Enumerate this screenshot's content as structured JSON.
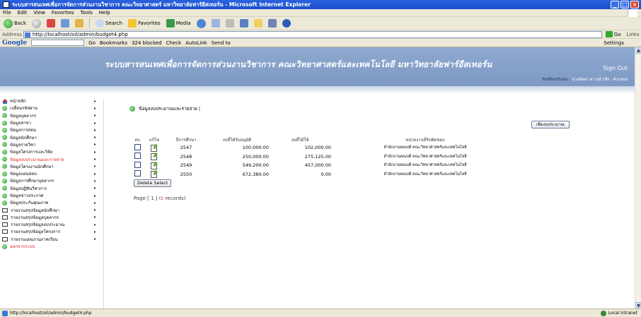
{
  "window": {
    "title": "ระบบสารสนเทศเพื่อการจัดการส่วนงานวิชาการ คณะวิทยาศาสตร์ มหาวิทยาลัยฟาร์อีสเทอร์น - Microsoft Internet Explorer"
  },
  "menu": [
    "File",
    "Edit",
    "View",
    "Favorites",
    "Tools",
    "Help"
  ],
  "toolbar": {
    "back": "Back",
    "search": "Search",
    "favorites": "Favorites",
    "media": "Media"
  },
  "address": {
    "label": "Address",
    "url": "http://localhost/oil/admin/budget4.php",
    "go": "Go",
    "links": "Links"
  },
  "google_bar": {
    "logo": "Google",
    "go": "Go",
    "bookmarks": "Bookmarks",
    "blocked": "324 blocked",
    "check": "Check",
    "autolink": "AutoLink",
    "sendto": "Send to",
    "settings": "Settings"
  },
  "banner": {
    "site_title": "ระบบสารสนเทศเพื่อการจัดการส่วนงานวิชาการ คณะวิทยาศาสตร์และเทคโนโลยี มหาวิทยาลัยฟาร์อีสเทอร์น",
    "signout": "Sign Out",
    "welcome_prefix": "ยินดีต้อนรับคุณ :",
    "welcome_user": "นางนัดดา ตาวงษ์ รหัส : ตำแหน่ง"
  },
  "sidebar": {
    "items": [
      {
        "icon": "home",
        "label": "หน้าหลัก",
        "active": false
      },
      {
        "icon": "bullet",
        "label": "เปลี่ยนรหัสผ่าน",
        "active": false
      },
      {
        "icon": "bullet",
        "label": "ข้อมูลบุคลากร",
        "active": false
      },
      {
        "icon": "bullet",
        "label": "ข้อมูลสาขา",
        "active": false
      },
      {
        "icon": "bullet",
        "label": "ข้อมูลการสอน",
        "active": false
      },
      {
        "icon": "bullet",
        "label": "ข้อมูลนักศึกษา",
        "active": false
      },
      {
        "icon": "bullet",
        "label": "ข้อมูลรายวิชา",
        "active": false
      },
      {
        "icon": "bullet",
        "label": "ข้อมูลโครงการและวิจัย",
        "active": false
      },
      {
        "icon": "bullet",
        "label": "ข้อมูลงบประมาณและรายจ่าย",
        "active": true
      },
      {
        "icon": "bullet",
        "label": "ข้อมูลโครงงานนักศึกษา",
        "active": false
      },
      {
        "icon": "bullet",
        "label": "ข้อมูลแผนสอบ",
        "active": false
      },
      {
        "icon": "bullet",
        "label": "ข้อมูลการศึกษาบุคลากร",
        "active": false
      },
      {
        "icon": "bullet",
        "label": "ข้อมูลปฏิทินวิชาการ",
        "active": false
      },
      {
        "icon": "bullet",
        "label": "ข้อมูลข่าวประกาศ",
        "active": false
      },
      {
        "icon": "bullet",
        "label": "ข้อมูลประกันคุณภาพ",
        "active": false
      },
      {
        "icon": "book",
        "label": "รายงานสรุปข้อมูลนักศึกษา",
        "active": false
      },
      {
        "icon": "book",
        "label": "รายงานสรุปข้อมูลบุคลากร",
        "active": false
      },
      {
        "icon": "book",
        "label": "รายงานสรุปข้อมูลงบประมาณ",
        "active": false
      },
      {
        "icon": "book",
        "label": "รายงานสรุปข้อมูลโครงการ",
        "active": false
      },
      {
        "icon": "book",
        "label": "รายงานแผนงานภาคเรียน",
        "active": false
      },
      {
        "icon": "bullet",
        "label": "ออกจากระบบ",
        "active": false,
        "red": true
      }
    ]
  },
  "main": {
    "breadcrumb": "ข้อมูลงบประมาณและรายจ่าย |",
    "add_button": "เพิ่มงบประมาณ",
    "columns": [
      "ลบ",
      "แก้ไข",
      "ปีการศึกษา",
      "งบที่ได้รับอนุมัติ",
      "งบที่ได้ใช้",
      "หน่วยงานที่รับผิดชอบ"
    ],
    "rows": [
      {
        "year": "2547",
        "approved": "100,000.00",
        "received": "102,000.00",
        "unit": "สำนักงานคณบดี คณะวิทยาศาสตร์และเทคโนโลยี"
      },
      {
        "year": "2548",
        "approved": "250,000.00",
        "received": "275,125.00",
        "unit": "สำนักงานคณบดี คณะวิทยาศาสตร์และเทคโนโลยี"
      },
      {
        "year": "2549",
        "approved": "549,200.00",
        "received": "457,000.00",
        "unit": "สำนักงานคณบดี คณะวิทยาศาสตร์และเทคโนโลยี"
      },
      {
        "year": "2550",
        "approved": "672,380.00",
        "received": "0.00",
        "unit": "สำนักงานคณบดี คณะวิทยาศาสตร์และเทคโนโลยี"
      }
    ],
    "delete_button": "Delete Select",
    "pager_prefix": "Page [ 1 ] (",
    "pager_link": "c",
    "pager_suffix": " records)"
  },
  "status": {
    "url": "http://localhost/oil/admin/budget4.php",
    "zone": "Local intranet"
  }
}
